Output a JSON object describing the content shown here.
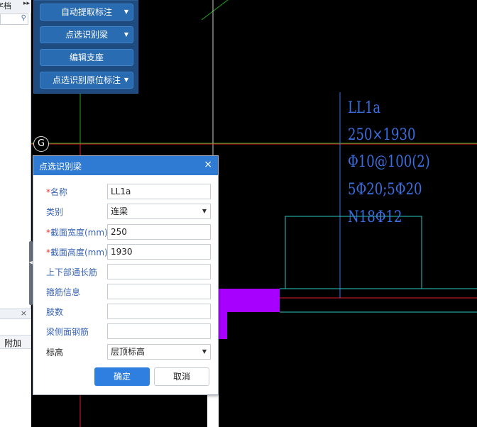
{
  "left_panel": {
    "title": "字档",
    "expand_arrows": "▸▸",
    "sub_close": "×",
    "sub_header": "附加"
  },
  "toolbar": {
    "items": [
      {
        "label": "自动提取标注",
        "has_dropdown": true
      },
      {
        "label": "点选识别梁",
        "has_dropdown": true
      },
      {
        "label": "编辑支座",
        "has_dropdown": false
      },
      {
        "label": "点选识别原位标注",
        "has_dropdown": true
      }
    ]
  },
  "axis": {
    "label": "G"
  },
  "cad_annotation": {
    "lines": [
      "LL1a",
      "250×1930",
      "Φ10@100(2)",
      "5Φ20;5Φ20",
      "N18Φ12"
    ],
    "color": "#3a6fe0"
  },
  "dialog": {
    "title": "点选识别梁",
    "close": "×",
    "fields": [
      {
        "label": "名称",
        "required": true,
        "value": "LL1a",
        "type": "input"
      },
      {
        "label": "类别",
        "required": false,
        "value": "连梁",
        "type": "select"
      },
      {
        "label": "截面宽度(mm)",
        "required": true,
        "value": "250",
        "type": "input"
      },
      {
        "label": "截面高度(mm)",
        "required": true,
        "value": "1930",
        "type": "input"
      },
      {
        "label": "上下部通长筋",
        "required": false,
        "value": "",
        "type": "input"
      },
      {
        "label": "箍筋信息",
        "required": false,
        "value": "",
        "type": "input"
      },
      {
        "label": "肢数",
        "required": false,
        "value": "",
        "type": "input"
      },
      {
        "label": "梁侧面钢筋",
        "required": false,
        "value": "",
        "type": "input"
      },
      {
        "label": "标高",
        "required": false,
        "value": "层顶标高",
        "type": "select"
      }
    ],
    "ok_label": "确定",
    "cancel_label": "取消"
  },
  "colors": {
    "canvas_bg": "#000000",
    "grid_green": "#1fa81f",
    "axis_red": "#e0202a",
    "cyan_outline": "#2ec4c4",
    "purple_fill": "#a800ff",
    "dialog_header": "#2f7ad3",
    "toolbar_bg": "#1f4c80"
  }
}
